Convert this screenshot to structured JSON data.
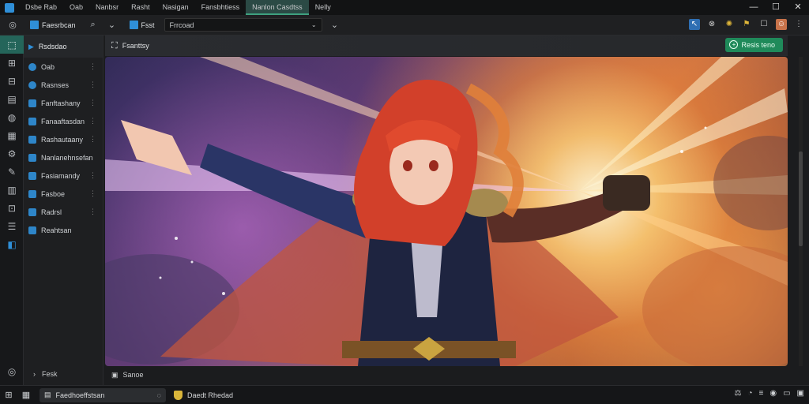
{
  "titlebar": {
    "menu": [
      "Dsbe Rab",
      "Oab",
      "Nanbsr",
      "Rasht",
      "Nasigan",
      "Fansbhtiess",
      "Nanlon Casdtss",
      "Nelly"
    ],
    "active_menu_index": 6,
    "window_controls": [
      "—",
      "☐",
      "✕"
    ]
  },
  "toolbar": {
    "project_label": "Faesrbcan",
    "path_label": "Fsst",
    "address_value": "Frrcoad",
    "accent": "#2f8fd8"
  },
  "iconbar": {
    "items": [
      "cursor-icon",
      "layers-icon",
      "cube-icon",
      "frame-icon",
      "globe-icon",
      "grid-icon",
      "settings-icon",
      "brush-icon",
      "chart-icon",
      "crop-icon",
      "list-icon",
      "tag-icon"
    ],
    "active_index": 0
  },
  "sidebar": {
    "header": "Rsdsdao",
    "items": [
      {
        "label": "Oab",
        "shape": "round"
      },
      {
        "label": "Rasnses",
        "shape": "round"
      },
      {
        "label": "Fanftashany",
        "shape": "square"
      },
      {
        "label": "Fanaaftasdan",
        "shape": "square"
      },
      {
        "label": "Rashautaany",
        "shape": "square"
      },
      {
        "label": "Nanlanehnsefan",
        "shape": "square"
      },
      {
        "label": "Fasiamandy",
        "shape": "square"
      },
      {
        "label": "Fasboe",
        "shape": "square"
      },
      {
        "label": "Radrsl",
        "shape": "square"
      },
      {
        "label": "Reahtsan",
        "shape": "square"
      }
    ],
    "footer": "Fesk"
  },
  "main": {
    "header": "Fsanttsy",
    "action_button": "Resis teno",
    "footer": "Sanoe"
  },
  "taskbar": {
    "search_text": "Faedhoeffstsan",
    "app_label": "Daedt Rhedad",
    "tray": [
      "⚖",
      "◔",
      "≡",
      "◉",
      "▭",
      "▣"
    ]
  }
}
